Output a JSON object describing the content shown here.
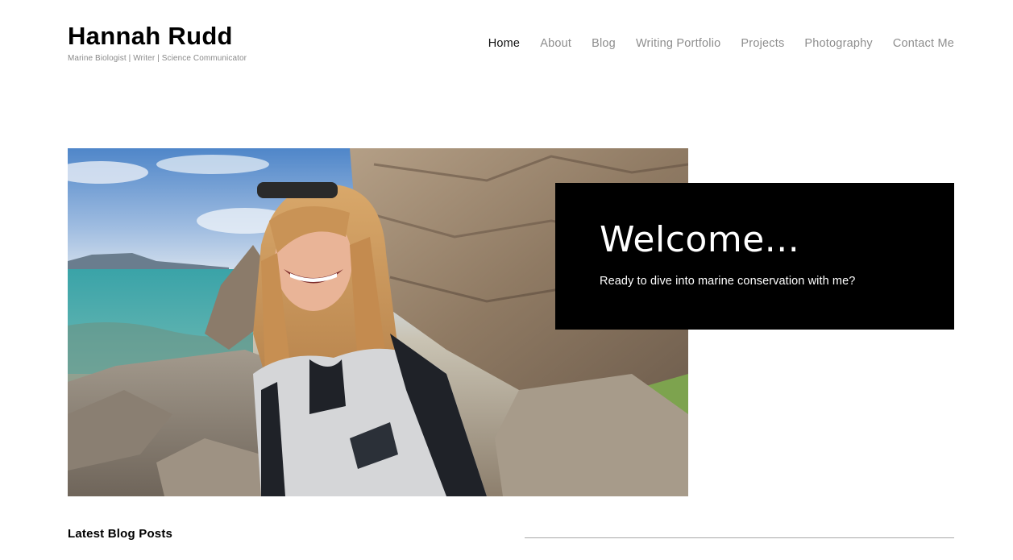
{
  "header": {
    "site_title": "Hannah Rudd",
    "tagline": "Marine Biologist | Writer | Science Communicator"
  },
  "nav": {
    "items": [
      {
        "label": "Home",
        "active": true
      },
      {
        "label": "About",
        "active": false
      },
      {
        "label": "Blog",
        "active": false
      },
      {
        "label": "Writing Portfolio",
        "active": false
      },
      {
        "label": "Projects",
        "active": false
      },
      {
        "label": "Photography",
        "active": false
      },
      {
        "label": "Contact Me",
        "active": false
      }
    ]
  },
  "hero": {
    "image_alt": "photo",
    "welcome_title": "Welcome...",
    "welcome_subtitle": "Ready to dive into marine conservation with me?"
  },
  "latest": {
    "heading": "Latest Blog Posts"
  },
  "colors": {
    "nav_text": "#8e8e8e",
    "nav_active": "#111111",
    "welcome_bg": "#000000",
    "divider": "#a8a8a8"
  }
}
